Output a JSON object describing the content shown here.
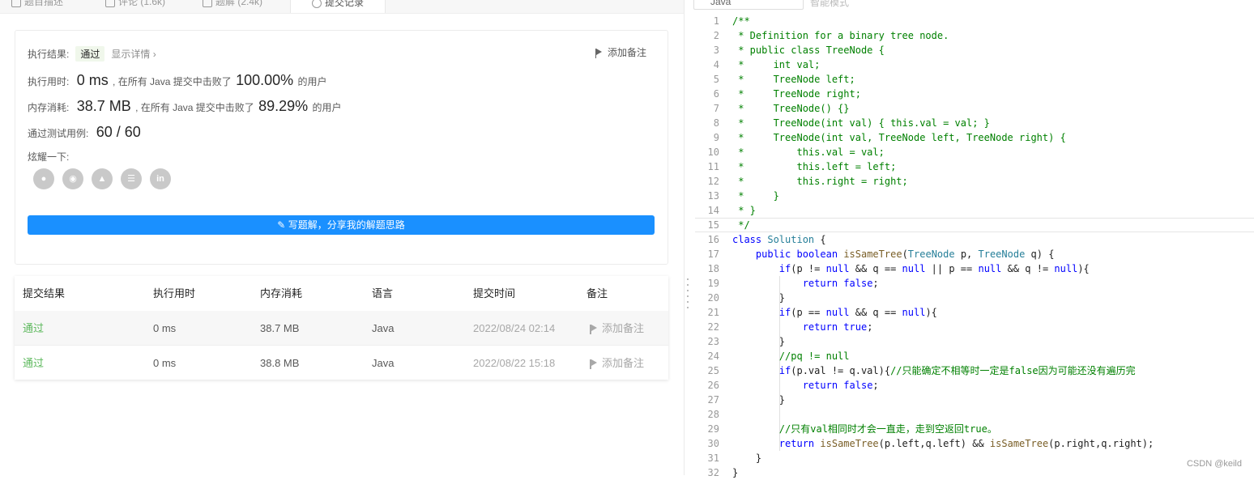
{
  "tabs": [
    {
      "label": "题目描述"
    },
    {
      "label": "评论 (1.6k)"
    },
    {
      "label": "题解 (2.4k)"
    },
    {
      "label": "提交记录"
    }
  ],
  "result": {
    "status_label": "执行结果:",
    "status_value": "通过",
    "details_link": "显示详情 ›",
    "add_note": "添加备注",
    "runtime_label": "执行用时:",
    "runtime_value": "0 ms",
    "runtime_mid": ", 在所有 Java 提交中击败了",
    "runtime_pct": "100.00%",
    "runtime_tail": "的用户",
    "memory_label": "内存消耗:",
    "memory_value": "38.7 MB",
    "memory_mid": ", 在所有 Java 提交中击败了",
    "memory_pct": "89.29%",
    "memory_tail": "的用户",
    "tests_label": "通过测试用例:",
    "tests_value": "60 / 60",
    "share_label": "炫耀一下:",
    "share_icons": [
      "wechat-icon",
      "weibo-icon",
      "qq-icon",
      "douban-icon",
      "linkedin-icon"
    ],
    "write_button": "写题解，分享我的解题思路"
  },
  "table": {
    "headers": [
      "提交结果",
      "执行用时",
      "内存消耗",
      "语言",
      "提交时间",
      "备注"
    ],
    "rows": [
      {
        "status": "通过",
        "runtime": "0 ms",
        "memory": "38.7 MB",
        "lang": "Java",
        "time": "2022/08/24 02:14",
        "note": "添加备注"
      },
      {
        "status": "通过",
        "runtime": "0 ms",
        "memory": "38.8 MB",
        "lang": "Java",
        "time": "2022/08/22 15:18",
        "note": "添加备注"
      }
    ]
  },
  "editor": {
    "language": "Java",
    "mode": "智能模式",
    "lines": [
      "/**",
      " * Definition for a binary tree node.",
      " * public class TreeNode {",
      " *     int val;",
      " *     TreeNode left;",
      " *     TreeNode right;",
      " *     TreeNode() {}",
      " *     TreeNode(int val) { this.val = val; }",
      " *     TreeNode(int val, TreeNode left, TreeNode right) {",
      " *         this.val = val;",
      " *         this.left = left;",
      " *         this.right = right;",
      " *     }",
      " * }",
      " */",
      "class Solution {",
      "    public boolean isSameTree(TreeNode p, TreeNode q) {",
      "        if(p != null && q == null || p == null && q != null){",
      "            return false;",
      "        }",
      "        if(p == null && q == null){",
      "            return true;",
      "        }",
      "        //pq != null",
      "        if(p.val != q.val){//只能确定不相等时一定是false因为可能还没有遍历完",
      "            return false;",
      "        }",
      "",
      "        //只有val相同时才会一直走，走到空返回true。",
      "        return isSameTree(p.left,q.left) && isSameTree(p.right,q.right);",
      "    }",
      "}"
    ]
  },
  "watermark": "CSDN @keild",
  "colors": {
    "accent": "#1a90ff",
    "pass": "#5cb85c",
    "comment": "#008000",
    "keyword": "#0000ff"
  }
}
